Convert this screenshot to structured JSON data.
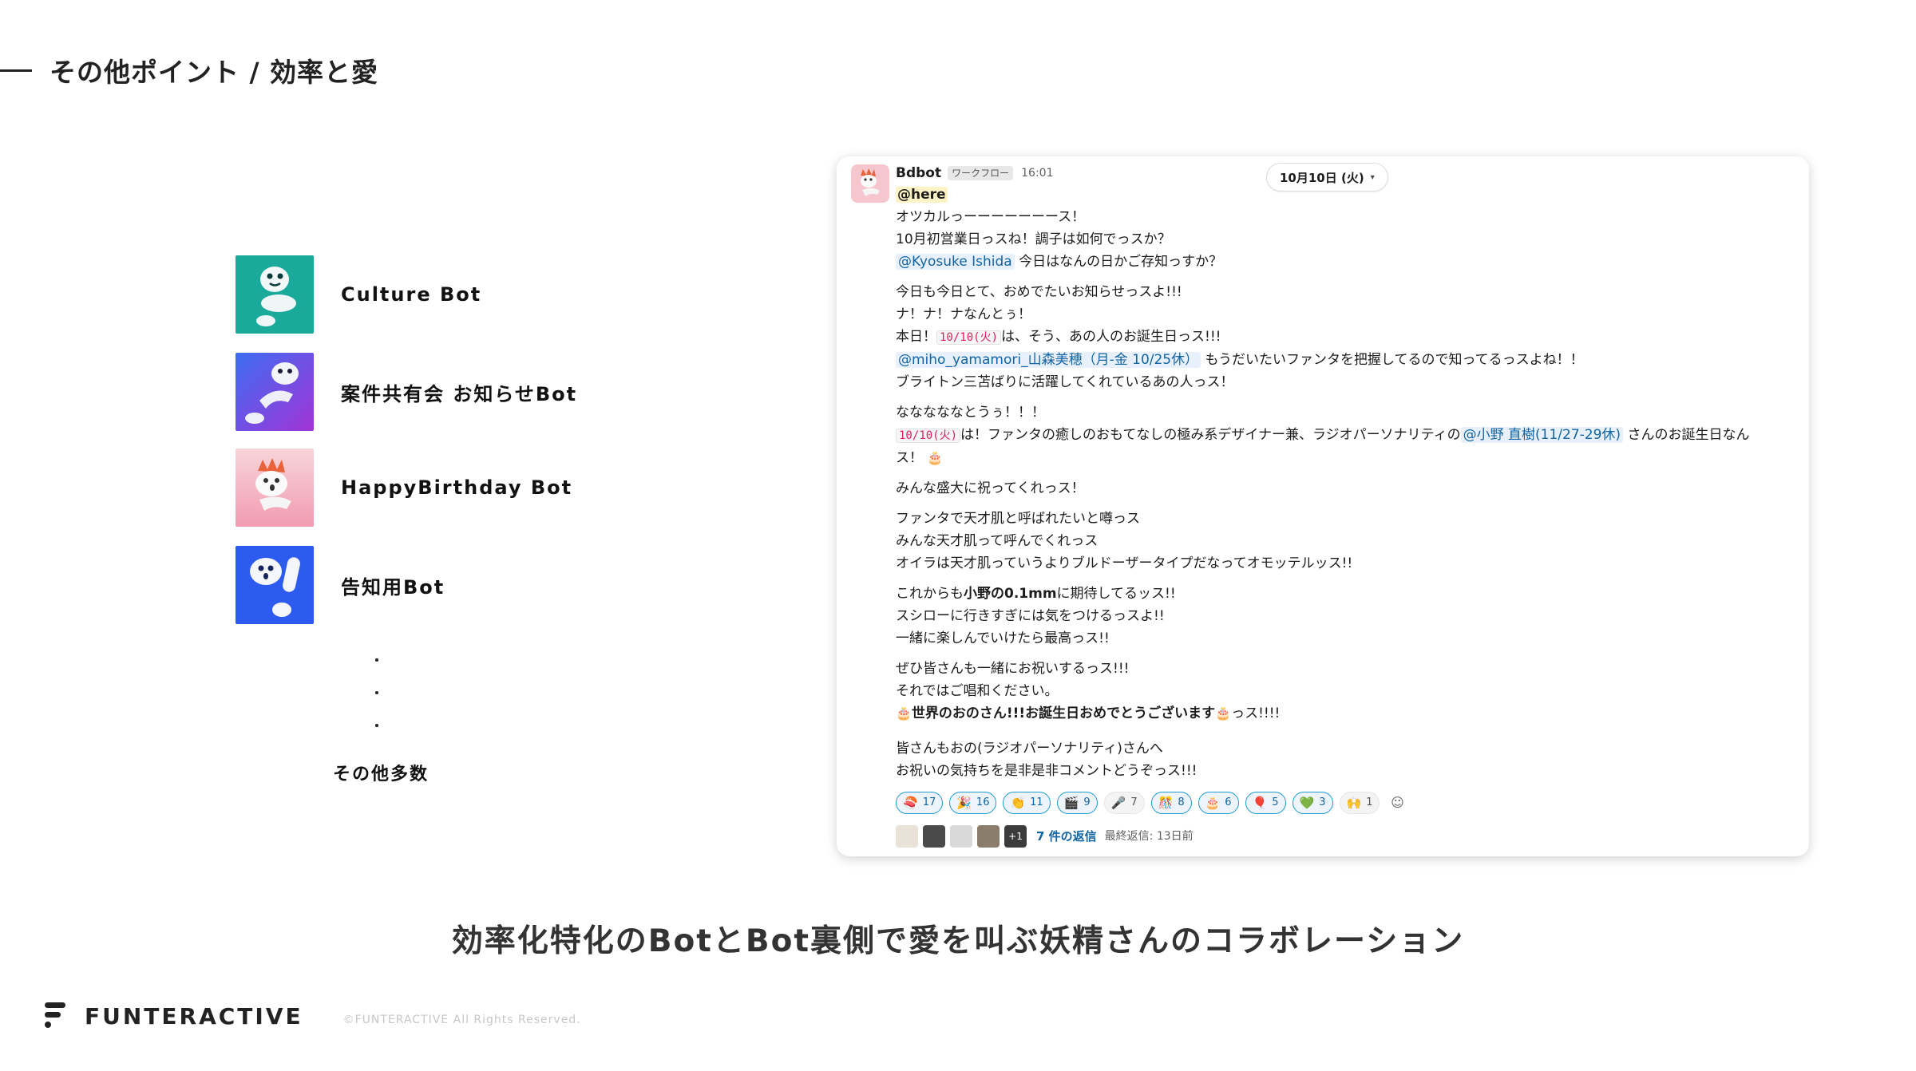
{
  "slide": {
    "title": "その他ポイント / 効率と愛",
    "tagline": "効率化特化のBotとBot裏側で愛を叫ぶ妖精さんのコラボレーション"
  },
  "bots": [
    {
      "name": "Culture Bot",
      "color": "#1aaa9c"
    },
    {
      "name": "案件共有会 お知らせBot",
      "color": "#6a3fdc"
    },
    {
      "name": "HappyBirthday Bot",
      "color": "#f5a3b6"
    },
    {
      "name": "告知用Bot",
      "color": "#2d5bf0"
    }
  ],
  "bots_more": "その他多数",
  "message": {
    "sender": "Bdbot",
    "badge": "ワークフロー",
    "time": "16:01",
    "date_pill": "10月10日 (火)",
    "here": "@here",
    "p1_l1": "オツカルっーーーーーーース！",
    "p1_l2": "10月初営業日っスね！調子は如何でっスか？",
    "p1_l3_mention": "@Kyosuke Ishida",
    "p1_l3_text": " 今日はなんの日かご存知っすか？",
    "p2_l1": "今日も今日とて、おめでたいお知らせっスよ!!!",
    "p2_l2": "ナ！ナ！ナなんとぅ！",
    "p2_l3_pre": "本日！",
    "p2_l3_code": "10/10(火)",
    "p2_l3_post": "は、そう、あの人のお誕生日っス!!!",
    "p2_l4_mention": "@miho_yamamori_山森美穂（月-金 10/25休）",
    "p2_l4_text": " もうだいたいファンタを把握してるので知ってるっスよね！！",
    "p2_l5": "ブライトン三苫ばりに活躍してくれているあの人っス！",
    "p3_l1": "なななななとうぅ！！！",
    "p3_l2_code": "10/10(火)",
    "p3_l2_text": "は！ファンタの癒しのおもてなしの極み系デザイナー兼、ラジオパーソナリティの",
    "p3_l2_mention": "@小野 直樹(11/27-29休)",
    "p3_l2_post": " さんのお誕生日なん",
    "p3_l3": "ス！",
    "p4_l1": "みんな盛大に祝ってくれっス！",
    "p5_l1": "ファンタで天才肌と呼ばれたいと噂っス",
    "p5_l2": "みんな天才肌って呼んでくれっス",
    "p5_l3": "オイラは天才肌っていうよりブルドーザータイプだなってオモッテルッス!!",
    "p6_l1_pre": "これからも",
    "p6_l1_bold": "小野の0.1mm",
    "p6_l1_post": "に期待してるッス!!",
    "p6_l2": "スシローに行きすぎには気をつけるっスよ!!",
    "p6_l3": "一緒に楽しんでいけたら最高っス!!",
    "p7_l1": "ぜひ皆さんも一緒にお祝いするっス!!!",
    "p7_l2": "それではご唱和ください。",
    "p7_l3_bold": "世界のおのさん!!!お誕生日おめでとうございます",
    "p7_l3_post": "っス!!!!",
    "p8_l1": "皆さんもおの(ラジオパーソナリティ)さんへ",
    "p8_l2": "お祝いの気持ちを是非是非コメントどうぞっス!!!",
    "reactions": [
      {
        "emoji": "🍣",
        "count": "17"
      },
      {
        "emoji": "🎉",
        "count": "16"
      },
      {
        "emoji": "👏",
        "count": "11"
      },
      {
        "emoji": "🎬",
        "count": "9"
      },
      {
        "emoji": "🎤",
        "count": "7"
      },
      {
        "emoji": "🎊",
        "count": "8"
      },
      {
        "emoji": "🎂",
        "count": "6"
      },
      {
        "emoji": "🎈",
        "count": "5"
      },
      {
        "emoji": "💚",
        "count": "3"
      },
      {
        "emoji": "🙌",
        "count": "1"
      }
    ],
    "thread": {
      "extra_count": "+1",
      "reply_count": "7 件の返信",
      "last_reply": "最終返信: 13日前"
    }
  },
  "footer": {
    "logo": "FUNTERACTIVE",
    "copyright": "©FUNTERACTIVE All Rights Reserved."
  }
}
